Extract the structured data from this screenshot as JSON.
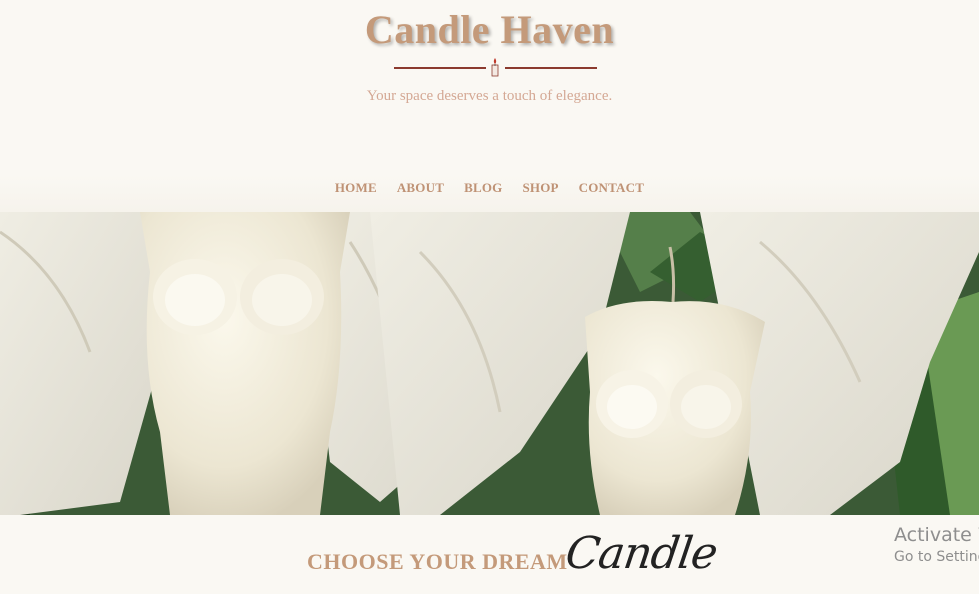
{
  "site": {
    "title": "Candle Haven",
    "tagline": "Your space deserves a touch of elegance."
  },
  "nav": {
    "items": [
      "HOME",
      "ABOUT",
      "BLOG",
      "SHOP",
      "CONTACT"
    ]
  },
  "hero": {
    "image": "white-fairy-candles-photo"
  },
  "section": {
    "heading": "CHOOSE YOUR DREAM",
    "script_word": "Candle"
  },
  "os_watermark": {
    "line1": "Activate Windows",
    "line2": "Go to Settings to activate Windows."
  },
  "colors": {
    "brand": "#c49a7a",
    "divider": "#8b3a2e",
    "background": "#faf8f3"
  }
}
